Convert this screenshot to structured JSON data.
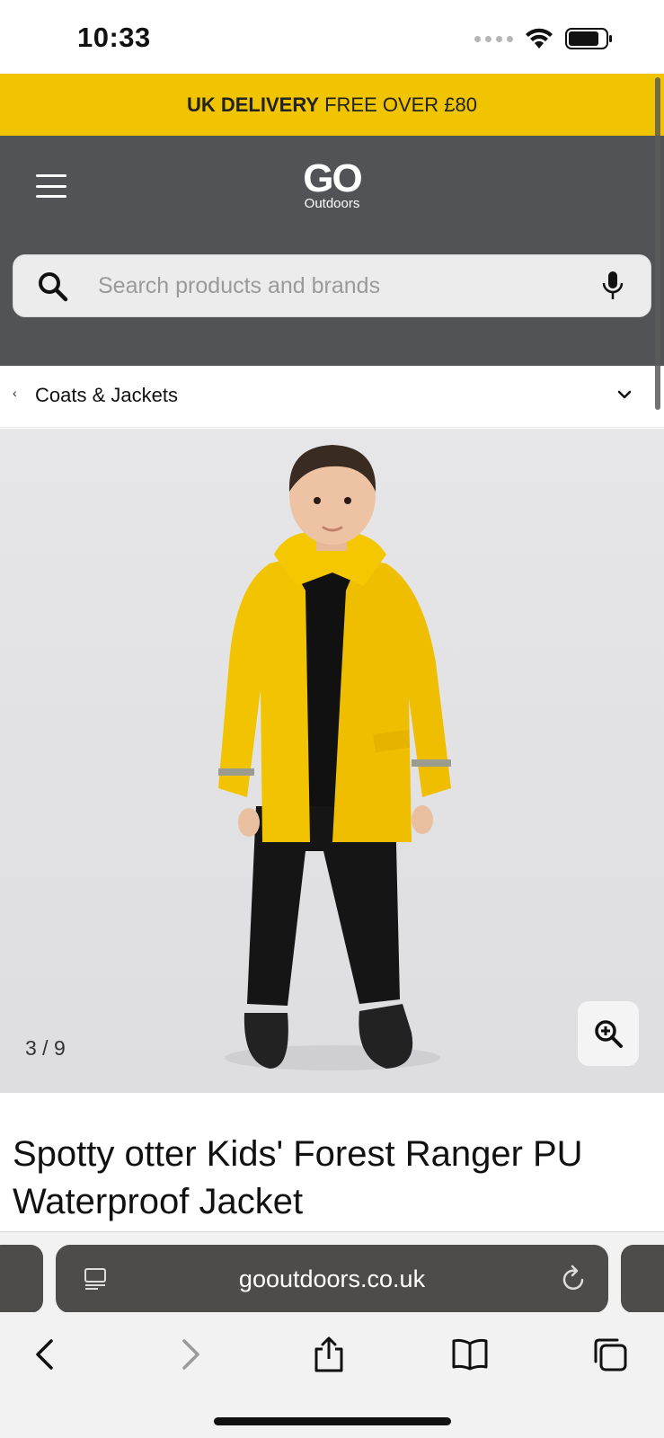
{
  "status_bar": {
    "time": "10:33"
  },
  "promo": {
    "bold": "UK DELIVERY",
    "text": "FREE OVER £80"
  },
  "header": {
    "logo_main": "GO",
    "logo_sub": "Outdoors",
    "search_placeholder": "Search products and brands"
  },
  "breadcrumb": {
    "back_glyph": "‹",
    "label": "Coats & Jackets"
  },
  "gallery": {
    "counter": "3 / 9"
  },
  "product": {
    "title": "Spotty otter Kids' Forest Ranger PU Waterproof Jacket"
  },
  "browser": {
    "url": "gooutdoors.co.uk"
  },
  "colors": {
    "promo": "#f1c400",
    "header": "#515356",
    "jacket": "#f2c300"
  },
  "icons": {
    "menu": "hamburger-icon",
    "search": "search-icon",
    "mic": "microphone-icon",
    "zoom": "zoom-in-icon",
    "back": "chevron-left-icon",
    "forward": "chevron-right-icon",
    "share": "share-icon",
    "bookmarks": "book-icon",
    "tabs": "tabs-icon"
  }
}
